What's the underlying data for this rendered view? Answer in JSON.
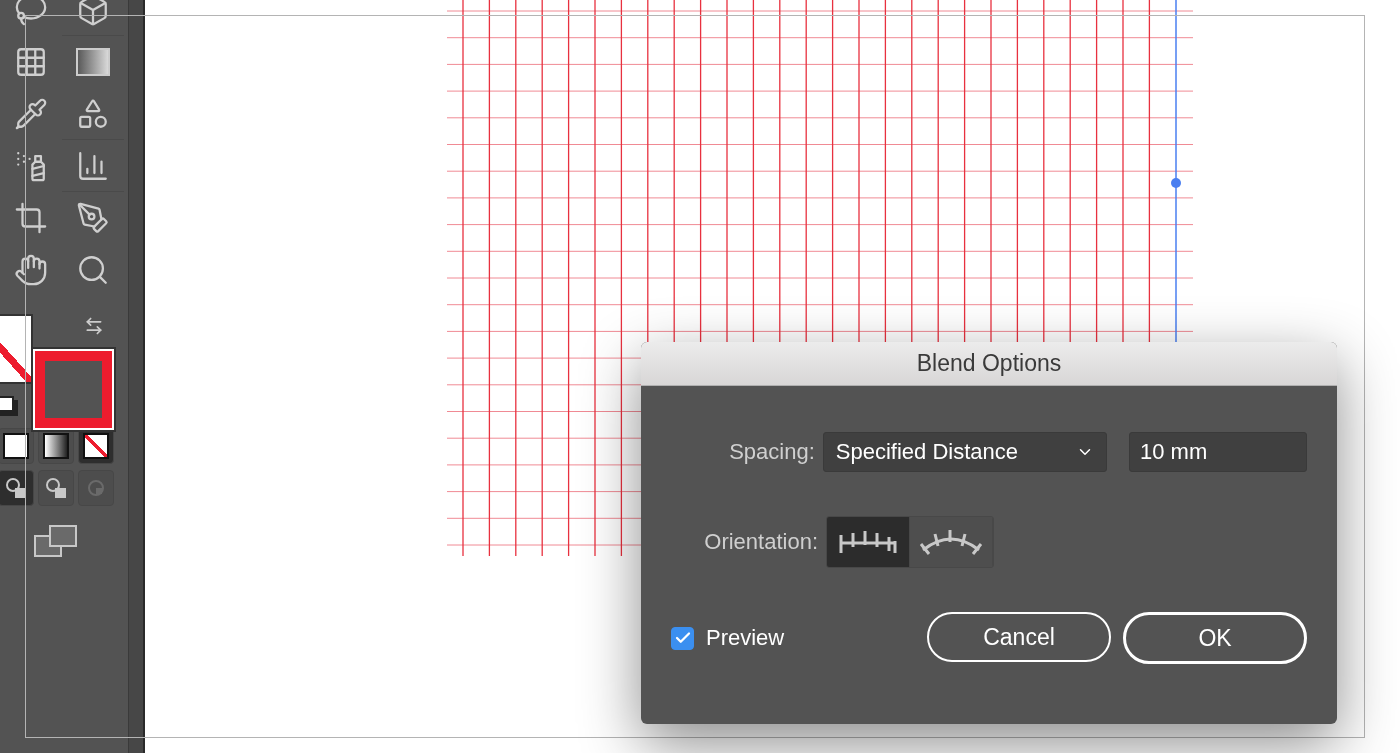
{
  "toolbar": {
    "swatch_modes": [
      {
        "kind": "color",
        "selected": false
      },
      {
        "kind": "gradient",
        "selected": false
      },
      {
        "kind": "none",
        "selected": true
      }
    ],
    "draw_modes": [
      {
        "kind": "normal",
        "selected": true,
        "disabled": false
      },
      {
        "kind": "behind",
        "selected": false,
        "disabled": false
      },
      {
        "kind": "inside",
        "selected": false,
        "disabled": true
      }
    ]
  },
  "dialog": {
    "title": "Blend Options",
    "spacing": {
      "label": "Spacing:",
      "value": "Specified Distance",
      "amount": "10 mm"
    },
    "orientation": {
      "label": "Orientation:",
      "options": [
        {
          "kind": "page",
          "selected": true
        },
        {
          "kind": "path",
          "selected": false
        }
      ]
    },
    "preview": {
      "label": "Preview",
      "checked": true
    },
    "buttons": [
      {
        "label": "Cancel",
        "default": false
      },
      {
        "label": "OK",
        "default": true
      }
    ]
  }
}
